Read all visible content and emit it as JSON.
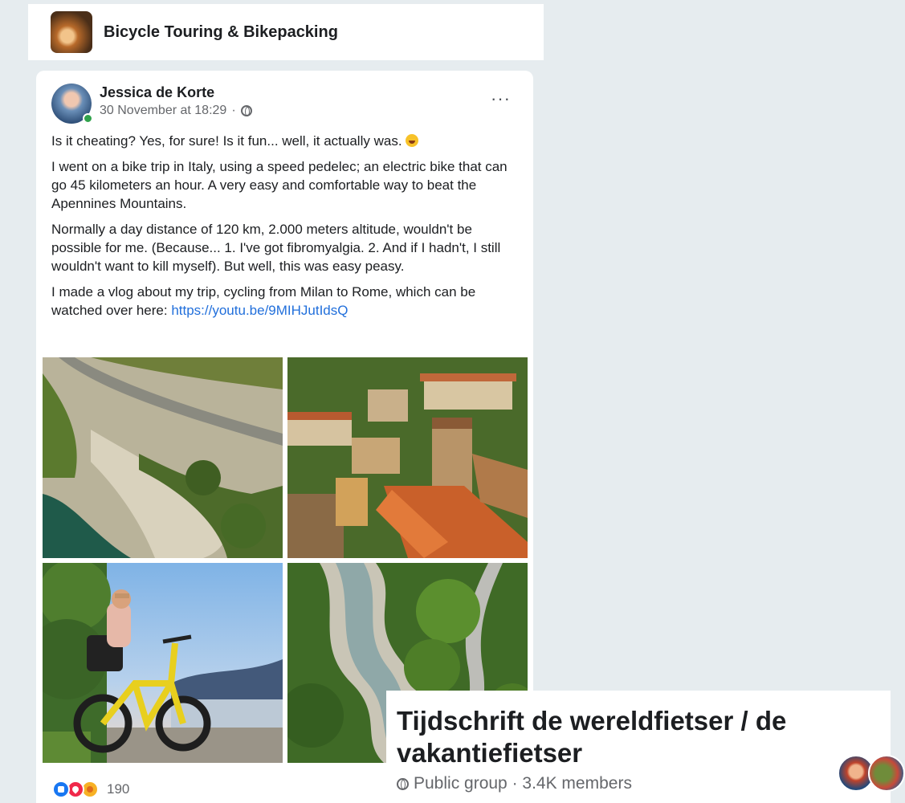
{
  "group": {
    "name": "Bicycle Touring & Bikepacking",
    "avatar_icon": "group-photo-icon"
  },
  "post": {
    "author": "Jessica de Korte",
    "timestamp": "30 November at 18:29",
    "meta_separator": "·",
    "privacy_icon": "globe-icon",
    "more_label": "···",
    "paragraphs": [
      "Is it cheating? Yes, for sure! Is it fun... well, it actually was.",
      "I went on a bike trip in Italy, using a speed pedelec; an electric bike that can go 45 kilometers an hour. A very easy and comfortable way to beat the Apennines Mountains.",
      "Normally a day distance of 120 km, 2.000 meters altitude, wouldn't be possible for me. (Because... 1. I've got fibromyalgia. 2. And if I hadn't, I still wouldn't want to kill myself). But well, this was easy peasy.",
      "I made a vlog about my trip, cycling from Milan to Rome, which can be watched over here:"
    ],
    "link": "https://youtu.be/9MIHJutIdsQ",
    "photos": [
      {
        "name": "aerial-coastal-road"
      },
      {
        "name": "aerial-hill-village"
      },
      {
        "name": "cyclist-with-yellow-bike"
      },
      {
        "name": "aerial-river-valley-road"
      }
    ],
    "reactions": {
      "icons": [
        "like",
        "love",
        "care"
      ],
      "count": "190"
    }
  },
  "overlay": {
    "title": "Tijdschrift de wereldfietser / de vakantiefietser",
    "meta": "Public group · 3.4K members"
  },
  "colors": {
    "page_bg": "#e6ecef",
    "link": "#216fdb",
    "meta_text": "#65676b"
  }
}
